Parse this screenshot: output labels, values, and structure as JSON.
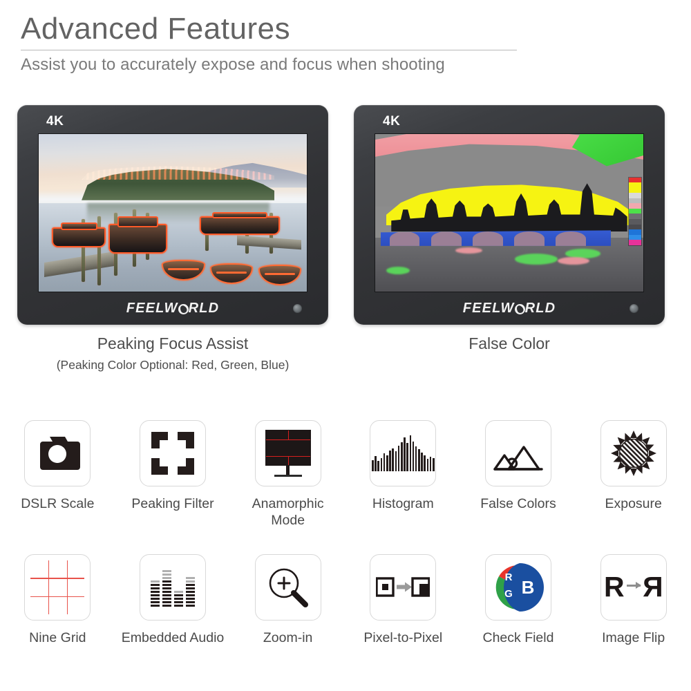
{
  "header": {
    "title": "Advanced Features",
    "subtitle": "Assist you to accurately expose and focus when shooting"
  },
  "monitors": [
    {
      "badge": "4K",
      "brand": "FEELWRLD",
      "brand_prefix": "FEELW",
      "brand_suffix": "RLD",
      "caption": "Peaking Focus Assist",
      "subcaption": "(Peaking Color Optional: Red, Green, Blue)",
      "scene": "lake-boats-peaking",
      "peaking_color": "#ff5a28"
    },
    {
      "badge": "4K",
      "brand": "FEELWRLD",
      "brand_prefix": "FEELW",
      "brand_suffix": "RLD",
      "caption": "False Color",
      "subcaption": "",
      "scene": "westminster-false-color",
      "scale_colors": [
        "#e8312f",
        "#f6f312",
        "#d9d9d9",
        "#bdbdbd",
        "#f2a8ae",
        "#4de04a",
        "#6e6e72",
        "#5a5a5e",
        "#4a4a4e",
        "#1e74d8",
        "#2f8de8",
        "#e8329a"
      ]
    }
  ],
  "features": [
    {
      "label": "DSLR Scale",
      "icon": "camera-icon"
    },
    {
      "label": "Peaking Filter",
      "icon": "focus-brackets-icon"
    },
    {
      "label": "Anamorphic\nMode",
      "icon": "monitor-guides-icon"
    },
    {
      "label": "Histogram",
      "icon": "histogram-icon"
    },
    {
      "label": "False Colors",
      "icon": "mountains-icon"
    },
    {
      "label": "Exposure",
      "icon": "sun-icon"
    },
    {
      "label": "Nine Grid",
      "icon": "grid-icon"
    },
    {
      "label": "Embedded\nAudio",
      "icon": "equalizer-icon"
    },
    {
      "label": "Zoom-in",
      "icon": "magnifier-plus-icon"
    },
    {
      "label": "Pixel-to-Pixel",
      "icon": "pixel-arrow-icon"
    },
    {
      "label": "Check Field",
      "icon": "rgb-pie-icon"
    },
    {
      "label": "Image Flip",
      "icon": "mirror-r-icon"
    }
  ],
  "icon_text": {
    "rgb_r": "R",
    "rgb_g": "G",
    "rgb_b": "B",
    "flip_left": "R",
    "flip_right": "R"
  },
  "colors": {
    "title": "#636363",
    "subtitle": "#7a7a7a",
    "label": "#4a4a4a",
    "icon_dark": "#241c1b",
    "grid_red": "#e8524a",
    "rgb_red": "#e8342b",
    "rgb_green": "#2fa148",
    "rgb_blue": "#1a4fa0",
    "bezel": "#313235"
  }
}
